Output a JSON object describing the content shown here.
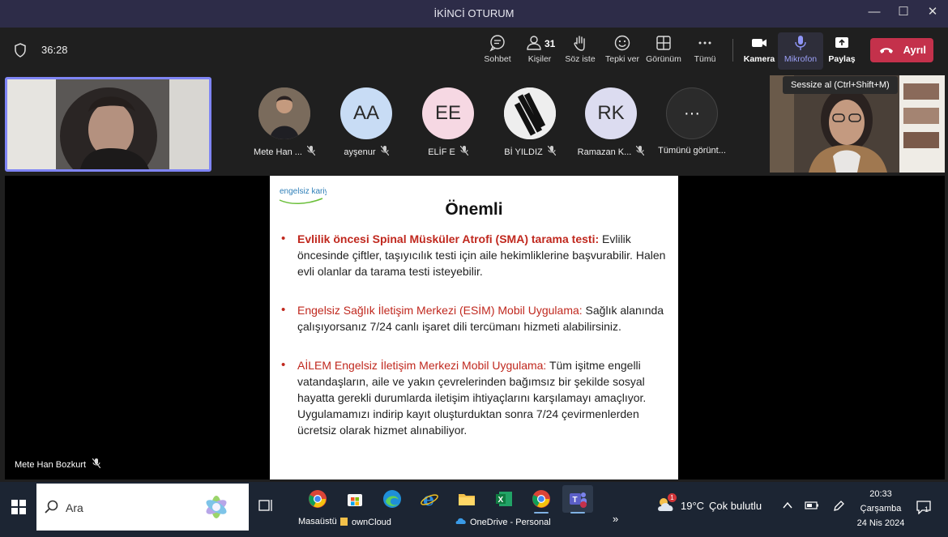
{
  "window": {
    "title": "İKİNCİ OTURUM",
    "minimize": "—",
    "maximize": "☐",
    "close": "✕"
  },
  "toolbar": {
    "timer": "36:28",
    "buttons": [
      {
        "label": "Sohbet",
        "icon": "chat-icon"
      },
      {
        "label": "Kişiler",
        "icon": "people-icon",
        "count": "31"
      },
      {
        "label": "Söz iste",
        "icon": "raise-hand-icon"
      },
      {
        "label": "Tepki ver",
        "icon": "smiley-icon"
      },
      {
        "label": "Görünüm",
        "icon": "grid-icon"
      },
      {
        "label": "Tümü",
        "icon": "more-icon"
      },
      {
        "label": "Kamera",
        "icon": "camera-icon"
      },
      {
        "label": "Mikrofon",
        "icon": "microphone-icon"
      },
      {
        "label": "Paylaş",
        "icon": "share-icon"
      }
    ],
    "leave_label": "Ayrıl",
    "tooltip": "Sessize al (Ctrl+Shift+M)"
  },
  "participants": [
    {
      "name": "Mete Han ...",
      "initials": "",
      "avatar_color": "#6b6b6b"
    },
    {
      "name": "ayşenur",
      "initials": "AA",
      "avatar_color": "#c8dcf5"
    },
    {
      "name": "ELİF E",
      "initials": "EE",
      "avatar_color": "#f6d8e3"
    },
    {
      "name": "Bİ YILDIZ",
      "initials": "",
      "avatar_color": "#e6e6e6"
    },
    {
      "name": "Ramazan K...",
      "initials": "RK",
      "avatar_color": "#dcdcf0"
    },
    {
      "name": "Tümünü görünt...",
      "initials": "···",
      "avatar_color": "#2b2b2b"
    }
  ],
  "slide": {
    "logo": "engelsiz kariyer",
    "title": "Önemli",
    "bullets": [
      {
        "heading": "Evlilik öncesi Spinal Müsküler Atrofi (SMA) tarama testi:",
        "body": " Evlilik öncesinde çiftler, taşıyıcılık testi için aile hekimliklerine başvurabilir. Halen evli olanlar da tarama testi isteyebilir."
      },
      {
        "heading": "Engelsiz Sağlık İletişim Merkezi (ESİM) Mobil Uygulama:",
        "body": " Sağlık alanında çalışıyorsanız 7/24 canlı işaret dili tercümanı hizmeti alabilirsiniz."
      },
      {
        "heading": "AİLEM Engelsiz İletişim Merkezi Mobil Uygulama:",
        "body": " Tüm işitme engelli vatandaşların, aile ve yakın çevrelerinden bağımsız bir şekilde sosyal hayatta gerekli durumlarda iletişim ihtiyaçlarını karşılamayı amaçlıyor. Uygulamamızı indirip kayıt oluşturduktan sonra 7/24 çevirmenlerden ücretsiz olarak hizmet alınabiliyor."
      }
    ]
  },
  "presenter_caption": "Mete Han Bozkurt",
  "taskbar": {
    "search_placeholder": "Ara",
    "desktop_label": "Masaüstü",
    "owncloud_label": "ownCloud",
    "onedrive_label": "OneDrive - Personal",
    "overflow": "»",
    "weather_temp": "19°C",
    "weather_desc": "Çok bulutlu",
    "weather_badge": "1",
    "time": "20:33",
    "day": "Çarşamba",
    "date": "24 Nis 2024",
    "notification_count": "1"
  },
  "colors": {
    "accent": "#7f85f5",
    "leave": "#c4314b",
    "slide_red": "#c0281e",
    "titlebar": "#2d2c48"
  }
}
